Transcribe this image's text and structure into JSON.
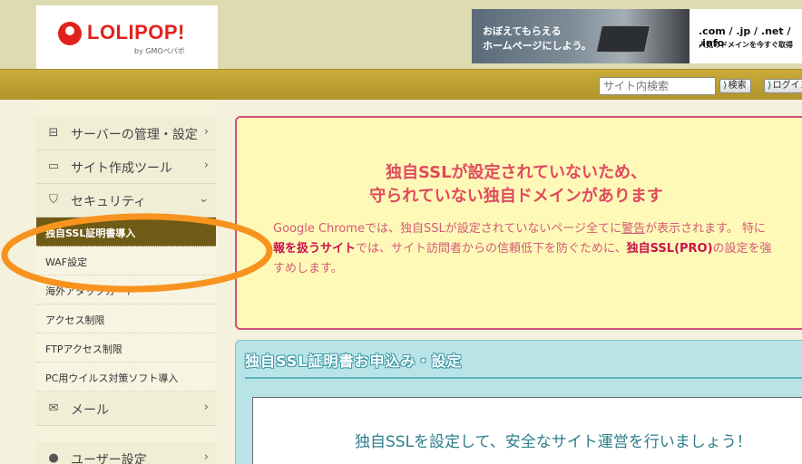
{
  "header": {
    "logo_text": "LOLIPOP!",
    "logo_sub": "by GMOペパボ",
    "banner": {
      "line1": "おぼえてもらえる",
      "line2": "ホームページにしよう。",
      "right_line1": ".com / .jp / .net / .info",
      "right_line2": "人気のドメインを今すぐ取得"
    }
  },
  "toolbar": {
    "search_placeholder": "サイト内検索",
    "search_button": "検索",
    "login_button": "ログイン"
  },
  "sidebar": {
    "menu": [
      {
        "label": "サーバーの管理・設定",
        "icon": "server-icon",
        "chevron": "›"
      },
      {
        "label": "サイト作成ツール",
        "icon": "laptop-icon",
        "chevron": "›"
      },
      {
        "label": "セキュリティ",
        "icon": "shield-icon",
        "chevron": "⌄"
      }
    ],
    "security_items": [
      "独自SSL証明書導入",
      "WAF設定",
      "海外アタックガード",
      "アクセス制限",
      "FTPアクセス制限",
      "PC用ウイルス対策ソフト導入"
    ],
    "mail": {
      "label": "メール",
      "icon": "mail-icon",
      "chevron": "›"
    },
    "user": {
      "label": "ユーザー設定",
      "icon": "user-icon",
      "chevron": "›"
    }
  },
  "alert": {
    "title_line1": "独自SSLが設定されていないため、",
    "title_line2": "守られていない独自ドメインがあります",
    "body_line1_prefix": "Google Chromeでは、独自SSLが設定されていないページ全てに",
    "body_line1_link": "警告",
    "body_line1_suffix": "が表示されます。 特に",
    "body_line2_bold1": "報を扱うサイト",
    "body_line2_mid": "では、サイト訪問者からの信頼低下を防ぐために、",
    "body_line2_bold2": "独自SSL(PRO)",
    "body_line2_suffix": "の設定を強",
    "body_line3": "すめします。"
  },
  "panel": {
    "title": "独自SSL証明書お申込み・設定",
    "message": "独自SSLを設定して、安全なサイト運営を行いましょう！"
  },
  "colors": {
    "olive_bar": "#b89c30",
    "alert_border": "#d0527c",
    "alert_title": "#e04a5e",
    "panel_bg": "#b8e4e8",
    "annotation": "#f7931e"
  }
}
